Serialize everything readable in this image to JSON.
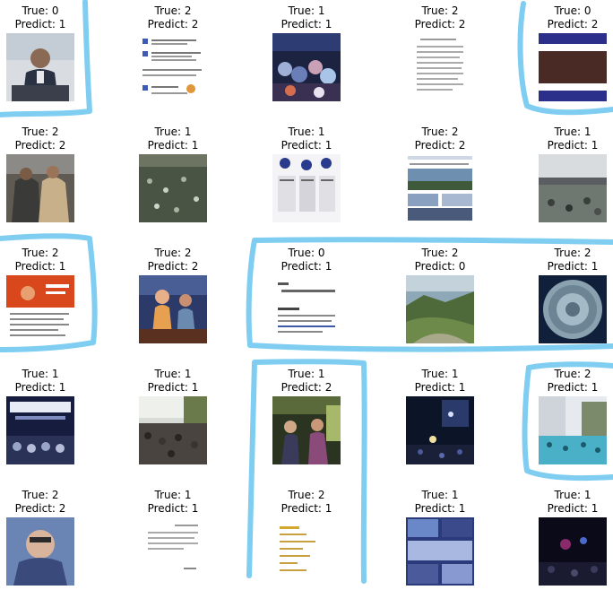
{
  "grid": {
    "cells": [
      {
        "true_label": "True: 0",
        "pred_label": "Predict: 1"
      },
      {
        "true_label": "True: 2",
        "pred_label": "Predict: 2"
      },
      {
        "true_label": "True: 1",
        "pred_label": "Predict: 1"
      },
      {
        "true_label": "True: 2",
        "pred_label": "Predict: 2"
      },
      {
        "true_label": "True: 0",
        "pred_label": "Predict: 2"
      },
      {
        "true_label": "True: 2",
        "pred_label": "Predict: 2"
      },
      {
        "true_label": "True: 1",
        "pred_label": "Predict: 1"
      },
      {
        "true_label": "True: 1",
        "pred_label": "Predict: 1"
      },
      {
        "true_label": "True: 2",
        "pred_label": "Predict: 2"
      },
      {
        "true_label": "True: 1",
        "pred_label": "Predict: 1"
      },
      {
        "true_label": "True: 2",
        "pred_label": "Predict: 1"
      },
      {
        "true_label": "True: 2",
        "pred_label": "Predict: 2"
      },
      {
        "true_label": "True: 0",
        "pred_label": "Predict: 1"
      },
      {
        "true_label": "True: 2",
        "pred_label": "Predict: 0"
      },
      {
        "true_label": "True: 2",
        "pred_label": "Predict: 1"
      },
      {
        "true_label": "True: 1",
        "pred_label": "Predict: 1"
      },
      {
        "true_label": "True: 1",
        "pred_label": "Predict: 1"
      },
      {
        "true_label": "True: 1",
        "pred_label": "Predict: 2"
      },
      {
        "true_label": "True: 1",
        "pred_label": "Predict: 1"
      },
      {
        "true_label": "True: 2",
        "pred_label": "Predict: 1"
      },
      {
        "true_label": "True: 2",
        "pred_label": "Predict: 2"
      },
      {
        "true_label": "True: 1",
        "pred_label": "Predict: 1"
      },
      {
        "true_label": "True: 2",
        "pred_label": "Predict: 1"
      },
      {
        "true_label": "True: 1",
        "pred_label": "Predict: 1"
      },
      {
        "true_label": "True: 1",
        "pred_label": "Predict: 1"
      }
    ]
  },
  "colors": {
    "highlight": "#7fcdf0"
  }
}
